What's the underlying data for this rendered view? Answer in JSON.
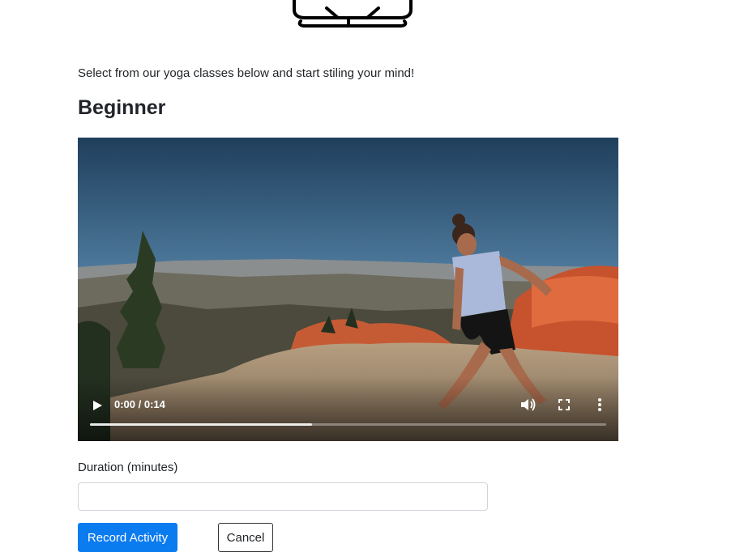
{
  "logo": {
    "icon": "yoga-meditation-icon"
  },
  "intro": {
    "text": "Select from our yoga classes below and start stiling your mind!"
  },
  "class": {
    "title": "Beginner",
    "video": {
      "time_display": "0:00 / 0:14",
      "progress": 0.43,
      "icons": {
        "play": "play-icon",
        "volume": "volume-icon",
        "fullscreen": "fullscreen-icon",
        "more": "more-options-icon"
      }
    }
  },
  "form": {
    "duration_label": "Duration (minutes)",
    "duration_value": "",
    "duration_placeholder": "",
    "submit_label": "Record Activity",
    "cancel_label": "Cancel"
  },
  "colors": {
    "primary": "#0b7bf0",
    "text": "#212529",
    "input_border": "#ced4da"
  }
}
